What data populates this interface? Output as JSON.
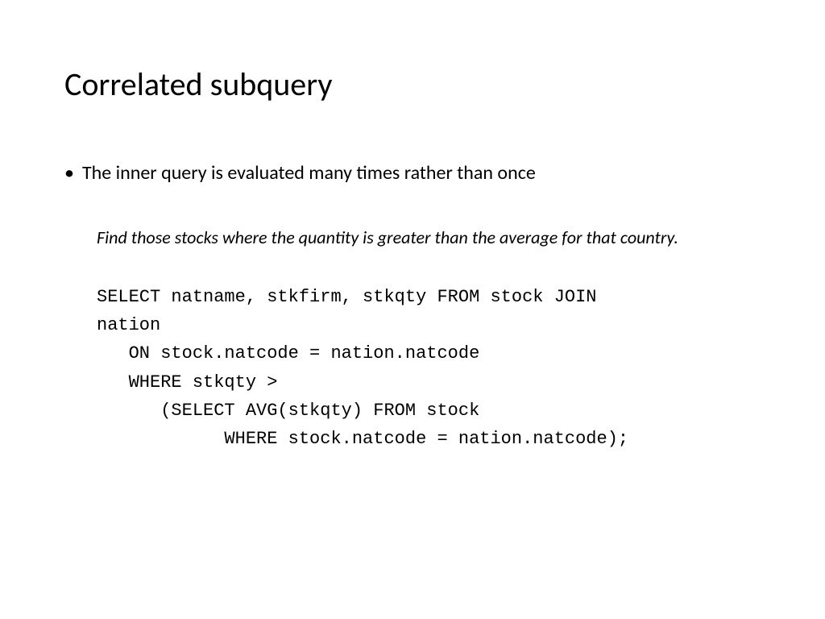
{
  "title": "Correlated subquery",
  "bullet": {
    "marker": "•",
    "text": "The inner query is evaluated many times rather than once"
  },
  "subtext": "Find those stocks where the quantity is greater than the average for that country.",
  "code": {
    "line1": "SELECT natname, stkfirm, stkqty FROM stock JOIN",
    "line2": "nation",
    "line3": "   ON stock.natcode = nation.natcode",
    "line4": "   WHERE stkqty >",
    "line5": "      (SELECT AVG(stkqty) FROM stock",
    "line6": "            WHERE stock.natcode = nation.natcode);"
  }
}
